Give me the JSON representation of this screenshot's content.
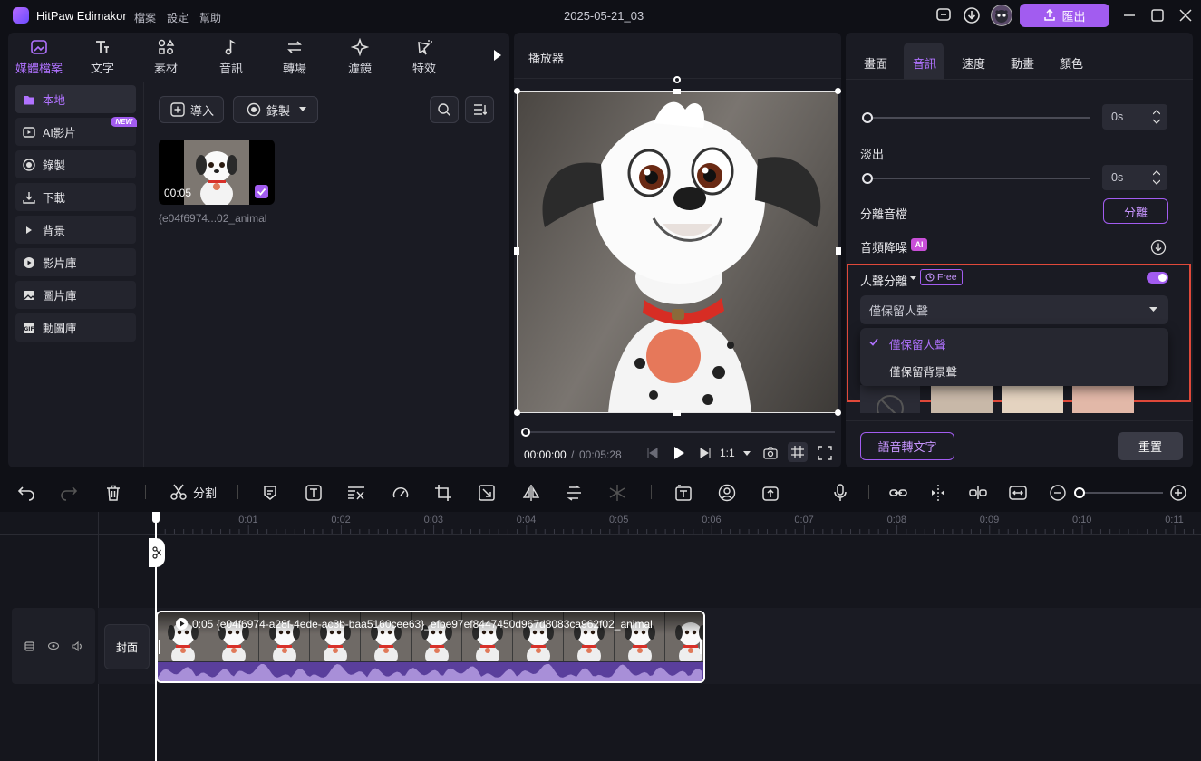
{
  "app": {
    "name": "HitPaw Edimakor",
    "menu": [
      "檔案",
      "設定",
      "幫助"
    ],
    "doc_title": "2025-05-21_03",
    "export_label": "匯出"
  },
  "left": {
    "tabs": [
      {
        "label": "媒體檔案",
        "icon": "media-icon"
      },
      {
        "label": "文字",
        "icon": "text-icon"
      },
      {
        "label": "素材",
        "icon": "shapes-icon"
      },
      {
        "label": "音訊",
        "icon": "music-icon"
      },
      {
        "label": "轉場",
        "icon": "transition-icon"
      },
      {
        "label": "濾鏡",
        "icon": "filter-icon"
      },
      {
        "label": "特效",
        "icon": "effects-icon"
      }
    ],
    "sidebar": [
      {
        "label": "本地",
        "icon": "folder-icon"
      },
      {
        "label": "AI影片",
        "icon": "ai-video-icon",
        "badge": "NEW"
      },
      {
        "label": "錄製",
        "icon": "record-icon"
      },
      {
        "label": "下載",
        "icon": "download-icon"
      },
      {
        "label": "背景",
        "icon": "background-icon"
      },
      {
        "label": "影片庫",
        "icon": "video-library-icon"
      },
      {
        "label": "圖片庫",
        "icon": "image-library-icon"
      },
      {
        "label": "動圖庫",
        "icon": "gif-icon"
      }
    ],
    "import_label": "導入",
    "record_label": "錄製",
    "media": {
      "duration": "00:05",
      "filename": "{e04f6974...02_animal"
    }
  },
  "player": {
    "title": "播放器",
    "current_time": "00:00:00",
    "separator": "/",
    "total_time": "00:05:28",
    "ratio": "1:1"
  },
  "right": {
    "tabs": [
      "畫面",
      "音訊",
      "速度",
      "動畫",
      "顏色"
    ],
    "active_tab": "音訊",
    "fade_in_value": "0s",
    "fade_out_label": "淡出",
    "fade_out_value": "0s",
    "separate_audio_label": "分離音檔",
    "separate_button": "分離",
    "denoise_label": "音頻降噪",
    "ai_badge": "AI",
    "vocal_label": "人聲分離",
    "free_badge": "Free",
    "vocal_selected": "僅保留人聲",
    "vocal_options": [
      "僅保留人聲",
      "僅保留背景聲"
    ],
    "stt_button": "語音轉文字",
    "reset_button": "重置"
  },
  "toolbar": {
    "split_label": "分割"
  },
  "timeline": {
    "ticks": [
      "0:01",
      "0:02",
      "0:03",
      "0:04",
      "0:05",
      "0:06",
      "0:07",
      "0:08",
      "0:09",
      "0:10",
      "0:11"
    ],
    "cover_label": "封面",
    "clip_label": "0:05 {e04f6974-a28f-4ede-ac3b-baa5160cee63}_efbe97ef8447450d967d8083ca962f02_animal"
  },
  "colors": {
    "accent": "#a25cf0",
    "panel": "#1a1b23",
    "bg": "#0f1016",
    "highlight_box": "#e0493a"
  }
}
